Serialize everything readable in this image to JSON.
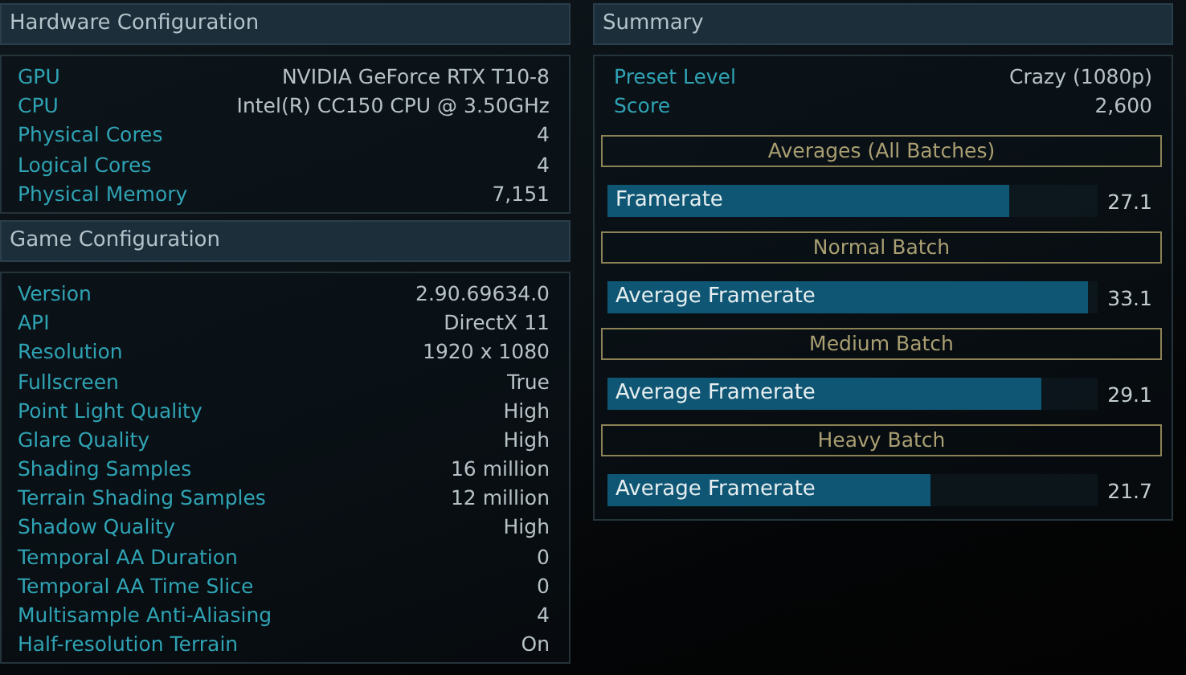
{
  "hardware": {
    "title": "Hardware Configuration",
    "rows": [
      {
        "label": "GPU",
        "value": "NVIDIA GeForce RTX T10-8"
      },
      {
        "label": "CPU",
        "value": "Intel(R) CC150 CPU @ 3.50GHz"
      },
      {
        "label": "Physical Cores",
        "value": "4"
      },
      {
        "label": "Logical Cores",
        "value": "4"
      },
      {
        "label": "Physical Memory",
        "value": "7,151"
      }
    ]
  },
  "game": {
    "title": "Game Configuration",
    "rows": [
      {
        "label": "Version",
        "value": "2.90.69634.0"
      },
      {
        "label": "API",
        "value": "DirectX 11"
      },
      {
        "label": "Resolution",
        "value": "1920 x 1080"
      },
      {
        "label": "Fullscreen",
        "value": "True"
      },
      {
        "label": "Point Light Quality",
        "value": "High"
      },
      {
        "label": "Glare Quality",
        "value": "High"
      },
      {
        "label": "Shading Samples",
        "value": "16 million"
      },
      {
        "label": "Terrain Shading Samples",
        "value": "12 million"
      },
      {
        "label": "Shadow Quality",
        "value": "High"
      },
      {
        "label": "Temporal AA Duration",
        "value": "0"
      },
      {
        "label": "Temporal AA Time Slice",
        "value": "0"
      },
      {
        "label": "Multisample Anti-Aliasing",
        "value": "4"
      },
      {
        "label": "Half-resolution Terrain",
        "value": "On"
      }
    ]
  },
  "summary": {
    "title": "Summary",
    "rows": [
      {
        "label": "Preset Level",
        "value": "Crazy (1080p)"
      },
      {
        "label": "Score",
        "value": "2,600"
      }
    ],
    "batches": [
      {
        "title": "Averages (All Batches)",
        "metric": "Framerate",
        "level": 0.82,
        "reading": "27.1"
      },
      {
        "title": "Normal Batch",
        "metric": "Average Framerate",
        "level": 0.98,
        "reading": "33.1"
      },
      {
        "title": "Medium Batch",
        "metric": "Average Framerate",
        "level": 0.885,
        "reading": "29.1"
      },
      {
        "title": "Heavy Batch",
        "metric": "Average Framerate",
        "level": 0.66,
        "reading": "21.7"
      }
    ]
  }
}
